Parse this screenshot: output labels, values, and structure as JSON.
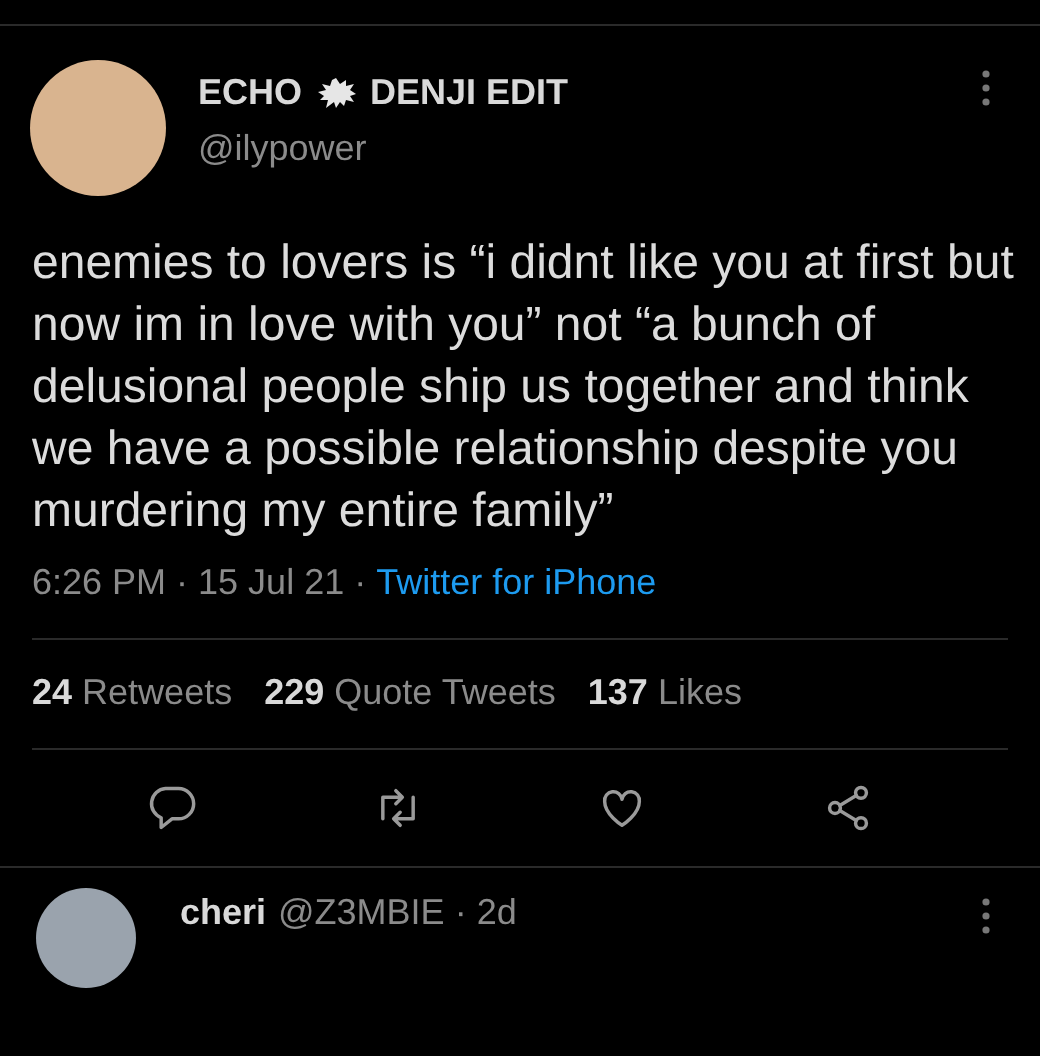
{
  "tweet": {
    "name_parts": [
      "ECHO",
      "DENJI EDIT"
    ],
    "handle": "@ilypower",
    "text": "enemies to lovers is “i didnt like you at first but now im in love with you” not “a bunch of delusional people ship us together and think we have a possible relationship despite you murdering my entire family”",
    "time": "6:26 PM · 15 Jul 21 ·",
    "source": "Twitter for iPhone",
    "stats": [
      {
        "count": "24",
        "label": "Retweets"
      },
      {
        "count": "229",
        "label": "Quote Tweets"
      },
      {
        "count": "137",
        "label": "Likes"
      }
    ]
  },
  "reply": {
    "name": "cheri",
    "meta": "@Z3MBIE · 2d"
  }
}
